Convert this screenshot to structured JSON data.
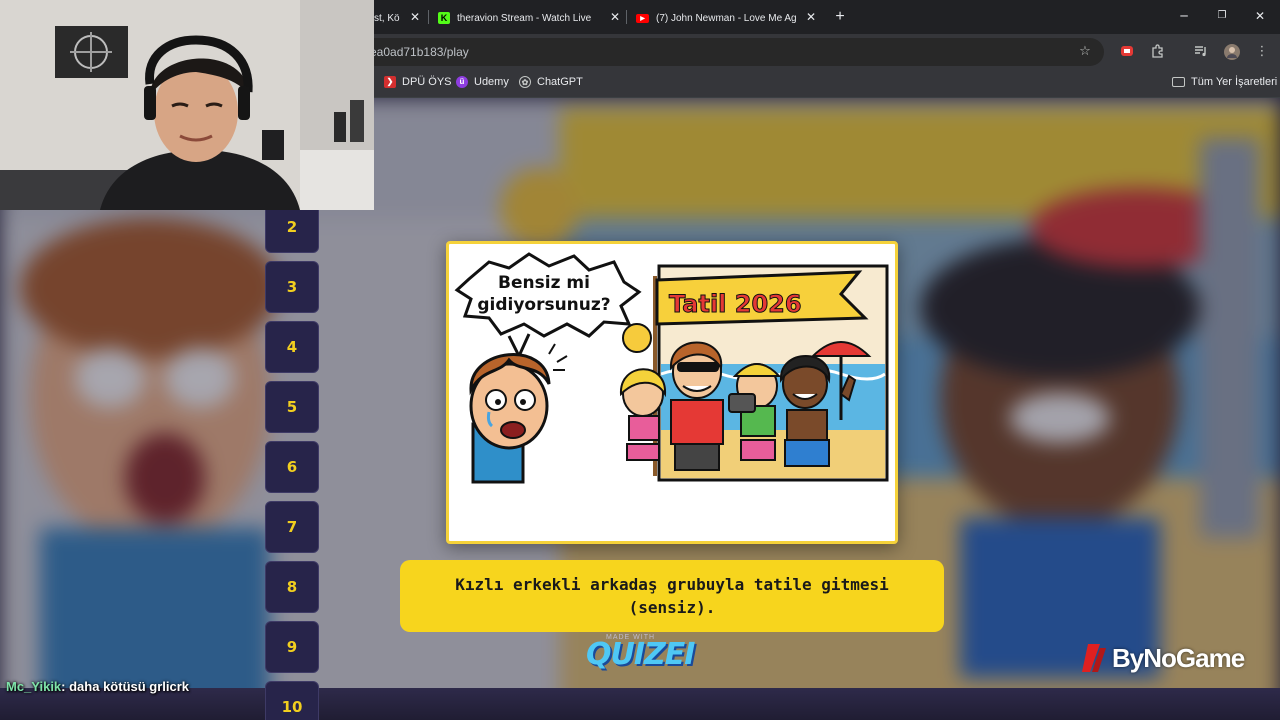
{
  "tabs": [
    {
      "title": "st, Kö",
      "active": false
    },
    {
      "title": "theravion Stream - Watch Live",
      "active": false
    },
    {
      "title": "(7) John Newman - Love Me Ag",
      "active": false
    }
  ],
  "address_bar": {
    "url": "ea0ad71b183/play"
  },
  "bookmarks": {
    "items": [
      {
        "label": "DPÜ ÖYS"
      },
      {
        "label": "Udemy"
      },
      {
        "label": "ChatGPT"
      }
    ],
    "all_bookmarks": "Tüm Yer İşaretleri"
  },
  "question_numbers": [
    "2",
    "3",
    "4",
    "5",
    "6",
    "7",
    "8",
    "9",
    "10"
  ],
  "comic": {
    "speech": "Bensiz mi gidiyorsunuz?",
    "banner": "Tatil 2026"
  },
  "caption": {
    "text": "Kızlı erkekli arkadaş grubuyla tatile gitmesi (sensiz)."
  },
  "brand": {
    "quizei": "QUIZEI",
    "quizei_small": "MADE WITH",
    "bynogame": "ByNoGame"
  },
  "chat": {
    "user": "Mc_Yikik",
    "message": ": daha kötüsü grlicrk"
  },
  "colors": {
    "accent_yellow": "#f7d51d",
    "number_yellow": "#f2cf1f",
    "chat_user": "#7ee2a8",
    "bynogame_red": "#e02020"
  }
}
